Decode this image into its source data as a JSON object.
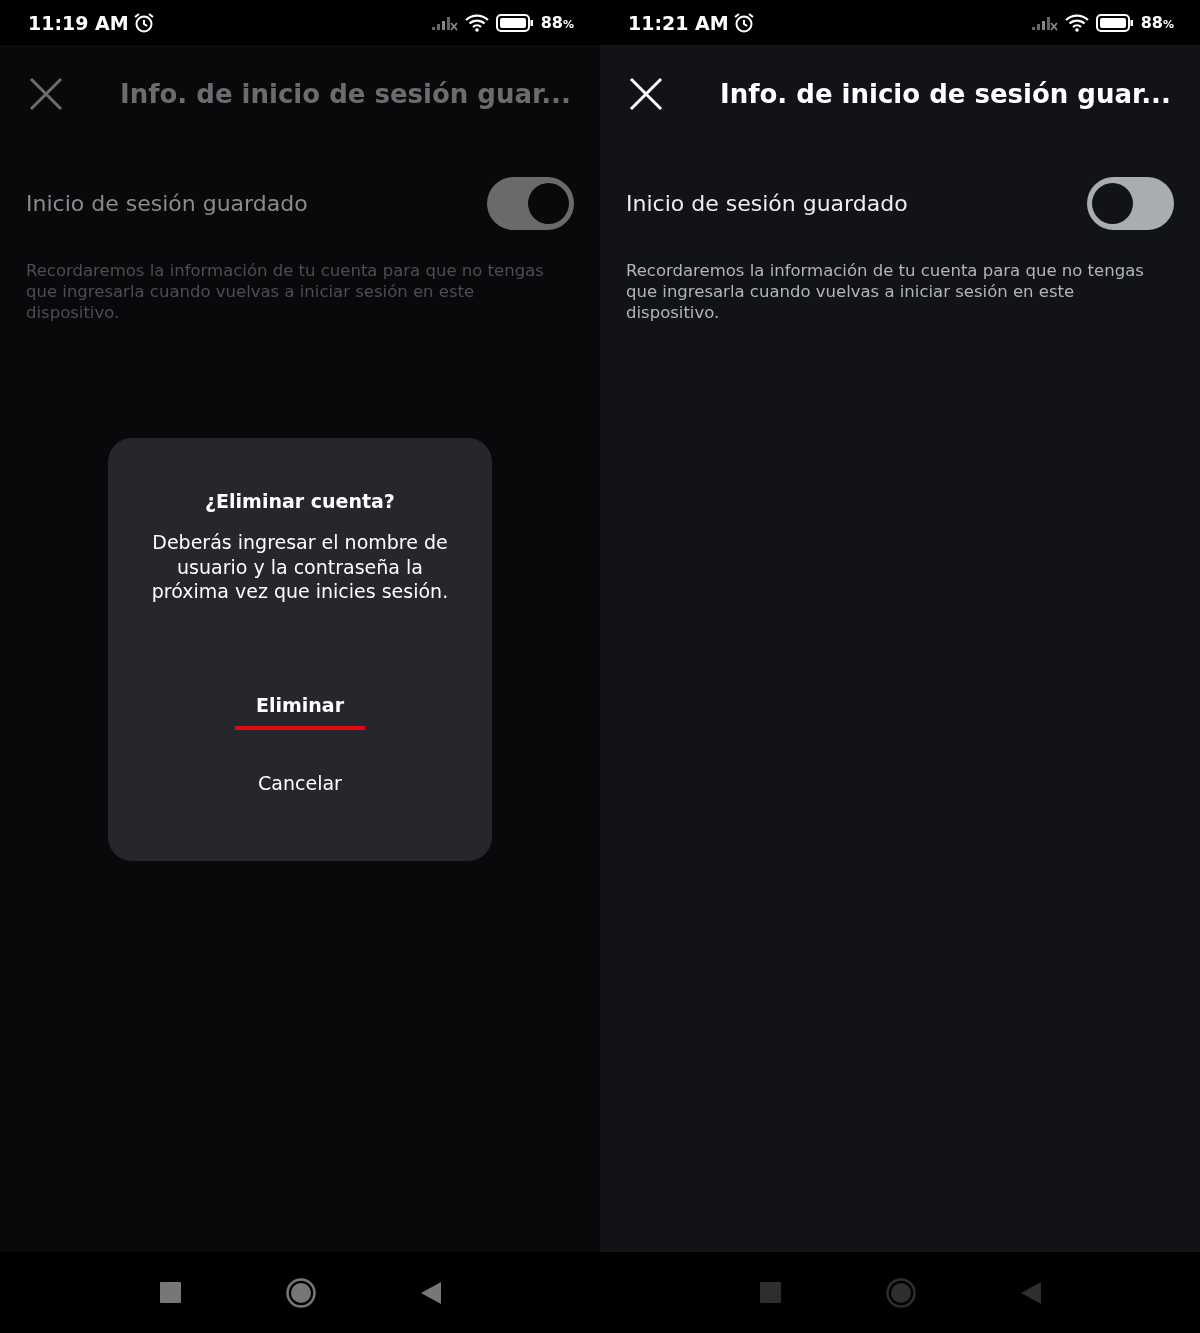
{
  "screens": [
    {
      "status_bar": {
        "time": "11:19 AM",
        "battery": "88",
        "battery_unit": "%"
      },
      "header": {
        "title": "Info. de inicio de sesión guar..."
      },
      "setting": {
        "label": "Inicio de sesión guardado",
        "on": true,
        "description": "Recordaremos la información de tu cuenta para que no tengas que ingresarla cuando vuelvas a iniciar sesión en este dispositivo."
      },
      "dialog": {
        "title": "¿Eliminar cuenta?",
        "message": "Deberás ingresar el nombre de usuario y la contraseña la próxima vez que inicies sesión.",
        "buttons": [
          {
            "label": "Eliminar",
            "selected": true
          },
          {
            "label": "Cancelar",
            "selected": false
          }
        ]
      }
    },
    {
      "status_bar": {
        "time": "11:21 AM",
        "battery": "88",
        "battery_unit": "%"
      },
      "header": {
        "title": "Info. de inicio de sesión guar..."
      },
      "setting": {
        "label": "Inicio de sesión guardado",
        "on": false,
        "description": "Recordaremos la información de tu cuenta para que no tengas que ingresarla cuando vuelvas a iniciar sesión en este dispositivo."
      }
    }
  ]
}
